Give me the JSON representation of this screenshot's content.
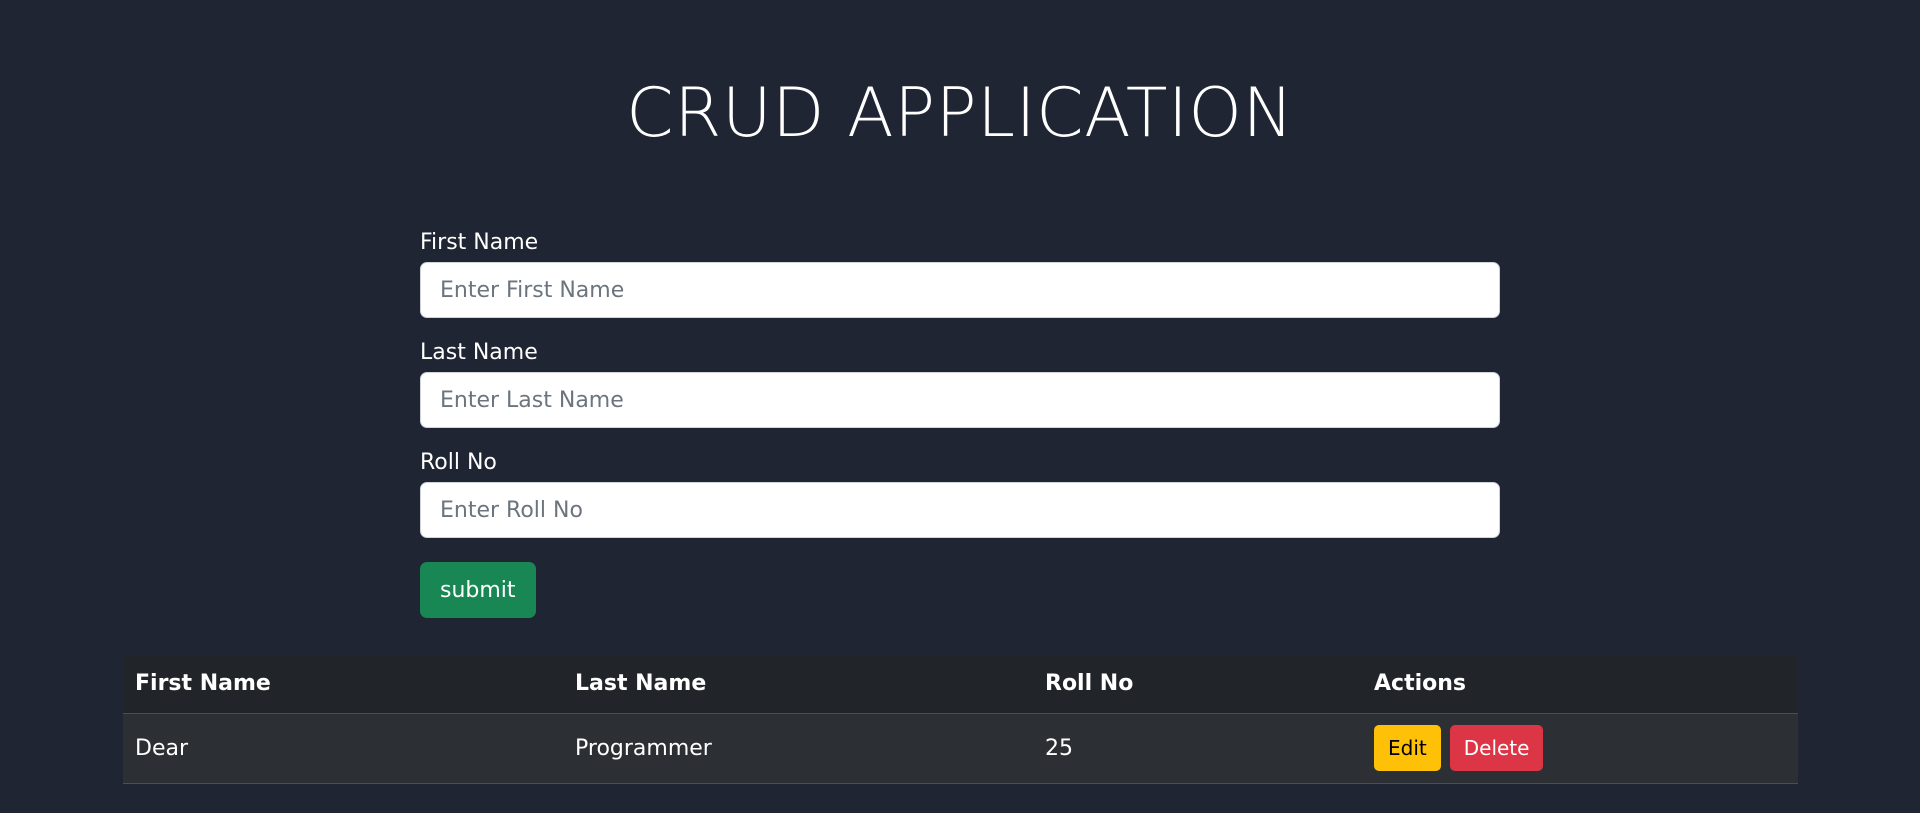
{
  "header": {
    "title": "CRUD APPLICATION"
  },
  "form": {
    "first_name": {
      "label": "First Name",
      "placeholder": "Enter First Name",
      "value": ""
    },
    "last_name": {
      "label": "Last Name",
      "placeholder": "Enter Last Name",
      "value": ""
    },
    "roll_no": {
      "label": "Roll No",
      "placeholder": "Enter Roll No",
      "value": ""
    },
    "submit_label": "submit"
  },
  "table": {
    "columns": [
      "First Name",
      "Last Name",
      "Roll No",
      "Actions"
    ],
    "rows": [
      {
        "first_name": "Dear",
        "last_name": "Programmer",
        "roll_no": "25",
        "edit_label": "Edit",
        "delete_label": "Delete"
      }
    ]
  },
  "colors": {
    "background": "#1f2532",
    "submit": "#198754",
    "edit": "#ffc107",
    "delete": "#dc3545",
    "table_header": "#212529",
    "table_row": "#2c3034"
  }
}
